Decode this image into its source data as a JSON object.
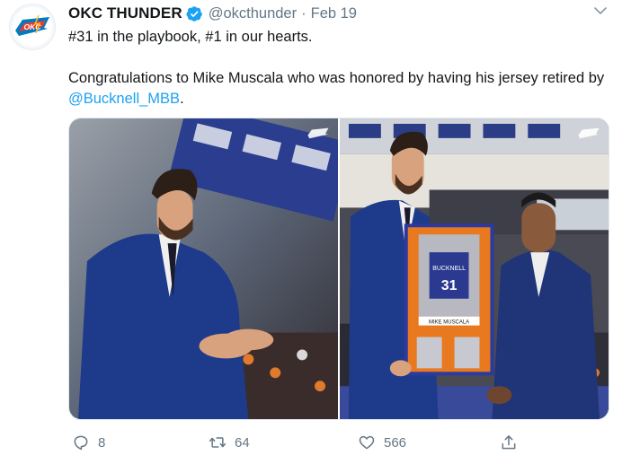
{
  "tweet": {
    "author_name": "OKC THUNDER",
    "handle": "@okcthunder",
    "separator": "·",
    "date": "Feb 19",
    "line1": "#31 in the playbook, #1 in our hearts.",
    "line2_prefix": "Congratulations to Mike Muscala who was honored by having his jersey retired by ",
    "mention": "@Bucknell_MBB",
    "line2_suffix": "."
  },
  "photos": [
    {
      "icon": "thunder-watermark-icon"
    },
    {
      "icon": "thunder-watermark-icon",
      "frame_text": "MIKE MUSCALA",
      "jersey_number": "31",
      "jersey_team": "BUCKNELL"
    }
  ],
  "actions": {
    "reply_count": "8",
    "retweet_count": "64",
    "like_count": "566"
  },
  "colors": {
    "accent": "#1da1f2",
    "muted": "#657786",
    "text": "#14171a"
  }
}
